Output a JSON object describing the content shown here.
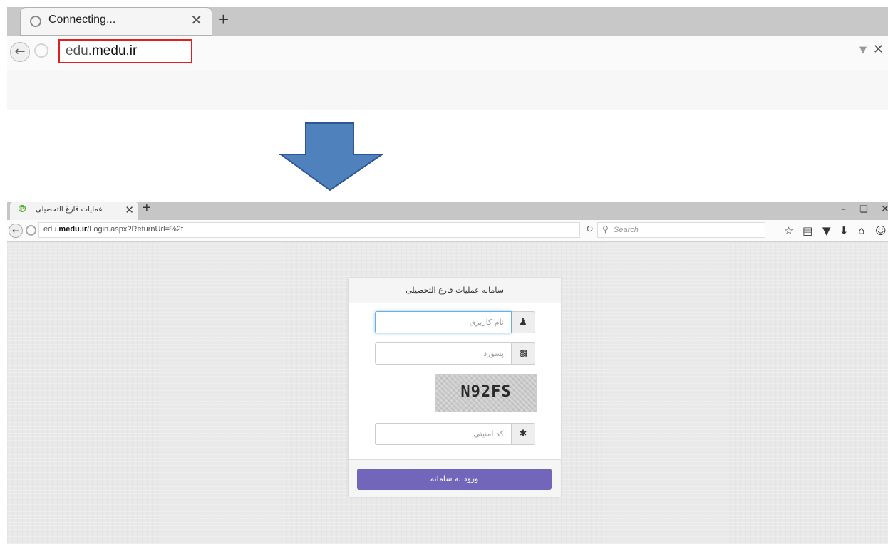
{
  "top_browser": {
    "tab_title": "Connecting...",
    "tab_close": "✕",
    "new_tab": "+",
    "url_host_prefix": "edu.",
    "url_host_main": "medu.ir",
    "url_end": "",
    "stop_label": "✕"
  },
  "bottom_browser": {
    "tab_title": "عملیات فارغ التحصیلی",
    "tab_close": "✕",
    "new_tab": "+",
    "url_host_prefix": "edu.",
    "url_host_main": "medu.ir",
    "url_path": "/Login.aspx?ReturnUrl=%2f",
    "search_placeholder": "Search",
    "window_controls": {
      "minimize": "–",
      "restore": "🗗",
      "close": "✕"
    }
  },
  "login": {
    "title": "سامانه عملیات فارغ التحصیلی",
    "username_placeholder": "نام کاربری",
    "password_placeholder": "پسورد",
    "captcha_text": "N92FS",
    "security_code_placeholder": "کد امنیتی",
    "submit_label": "ورود به سامانه"
  },
  "colors": {
    "url_highlight": "#e02020",
    "arrow_fill": "#4f81bd",
    "login_button": "#7266ba"
  },
  "icons": [
    "spinner-icon",
    "back-icon",
    "globe-icon",
    "dropdown-icon",
    "stop-icon",
    "reload-icon",
    "search-icon",
    "bookmark-star-icon",
    "reading-list-icon",
    "pocket-icon",
    "download-icon",
    "home-icon",
    "smiley-icon",
    "menu-icon",
    "user-icon",
    "lock-icon",
    "asterisk-icon",
    "down-arrow-icon"
  ]
}
